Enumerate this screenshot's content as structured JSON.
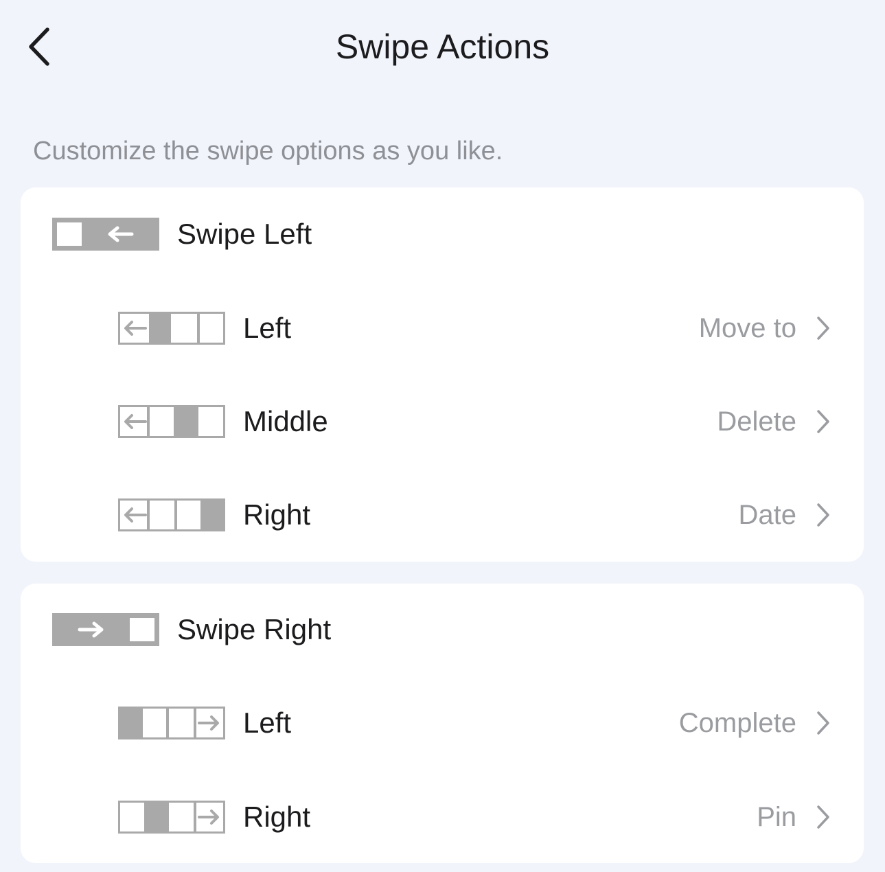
{
  "header": {
    "title": "Swipe Actions",
    "back_icon": "chevron-left-icon"
  },
  "subtitle": "Customize the swipe options as you like.",
  "sections": [
    {
      "title": "Swipe Left",
      "icon": "swipe-left-icon",
      "rows": [
        {
          "label": "Left",
          "value": "Move to",
          "icon": "swipe-left-slot-left-icon"
        },
        {
          "label": "Middle",
          "value": "Delete",
          "icon": "swipe-left-slot-middle-icon"
        },
        {
          "label": "Right",
          "value": "Date",
          "icon": "swipe-left-slot-right-icon"
        }
      ]
    },
    {
      "title": "Swipe Right",
      "icon": "swipe-right-icon",
      "rows": [
        {
          "label": "Left",
          "value": "Complete",
          "icon": "swipe-right-slot-left-icon"
        },
        {
          "label": "Right",
          "value": "Pin",
          "icon": "swipe-right-slot-right-icon"
        }
      ]
    }
  ],
  "colors": {
    "background": "#f1f4fb",
    "card": "#ffffff",
    "icon_gray": "#a9a9a9",
    "value_gray": "#9a9ca0",
    "text": "#1c1c1e"
  }
}
